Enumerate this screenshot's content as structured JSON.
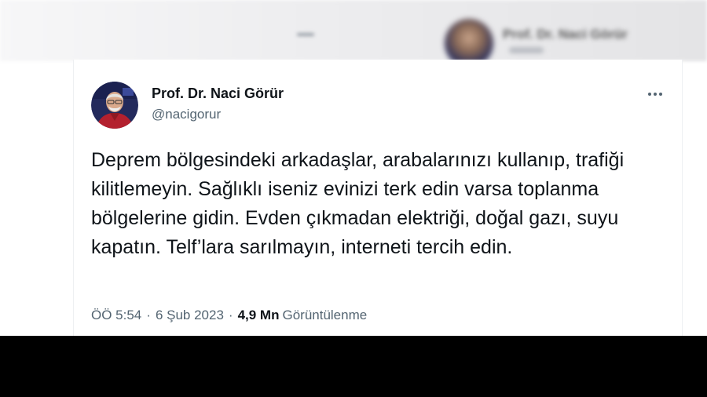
{
  "background": {
    "blurred_name": "Prof. Dr. Naci Görür"
  },
  "tweet": {
    "author_name": "Prof. Dr. Naci Görür",
    "author_handle": "@nacigorur",
    "text": "Deprem bölgesindeki arkadaşlar, arabalarınızı kullanıp, trafiği kilitlemeyin. Sağlıklı iseniz evinizi terk edin varsa toplanma bölgelerine gidin. Evden çıkmadan elektriği, doğal gazı, suyu kapatın. Telf’lara sarılmayın, interneti tercih edin.",
    "time": "ÖÖ 5:54",
    "date": "6 Şub 2023",
    "separator": "·",
    "views_count": "4,9 Mn",
    "views_label": "Görüntülenme",
    "icons": {
      "more": "more-horizontal-icon",
      "avatar": "profile-photo"
    },
    "colors": {
      "text_primary": "#0f1419",
      "text_secondary": "#536471"
    }
  }
}
